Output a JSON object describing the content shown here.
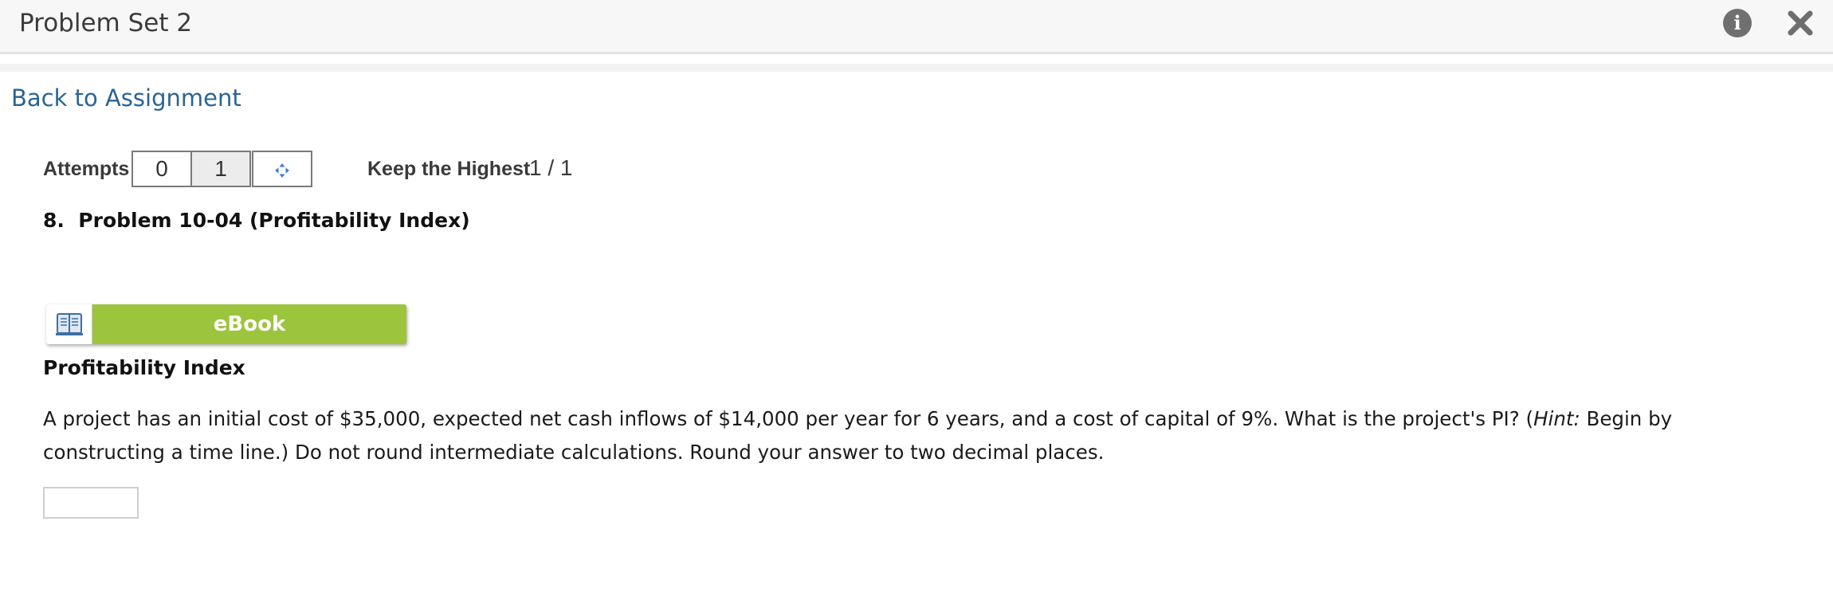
{
  "header": {
    "title": "Problem Set 2",
    "info_icon": "info-icon",
    "close_icon": "close-icon"
  },
  "nav": {
    "back_link": "Back to Assignment"
  },
  "attempts": {
    "label": "Attempts",
    "boxes": [
      "0",
      "1"
    ],
    "more_icon": "move-arrows-icon",
    "keep_label": "Keep the Highest",
    "keep_score": "1 / 1"
  },
  "problem": {
    "title": "8.  Problem 10-04 (Profitability Index)",
    "ebook_label": "eBook",
    "ebook_icon": "book-icon",
    "section_heading": "Profitability Index",
    "question_part1": "A project has an initial cost of $35,000, expected net cash inflows of $14,000 per year for 6 years, and a cost of capital of 9%. What is the project's PI? (",
    "question_hint_label": "Hint:",
    "question_part2": " Begin by constructing a time line.) Do not round intermediate calculations. Round your answer to two decimal places.",
    "answer_value": ""
  },
  "colors": {
    "link": "#2a6496",
    "ebook_green": "#9cc43c",
    "header_bg": "#f7f7f7",
    "icon_gray": "#707070"
  }
}
